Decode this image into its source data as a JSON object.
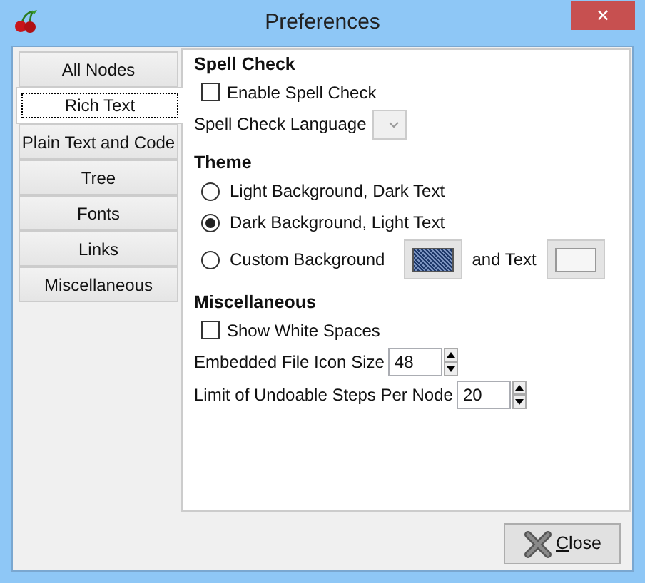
{
  "window": {
    "title": "Preferences",
    "close": "✕"
  },
  "tabs": [
    {
      "label": "All Nodes",
      "selected": false
    },
    {
      "label": "Rich Text",
      "selected": true
    },
    {
      "label": "Plain Text and Code",
      "selected": false
    },
    {
      "label": "Tree",
      "selected": false
    },
    {
      "label": "Fonts",
      "selected": false
    },
    {
      "label": "Links",
      "selected": false
    },
    {
      "label": "Miscellaneous",
      "selected": false
    }
  ],
  "sections": [
    {
      "title": "Spell Check",
      "items": [
        {
          "kind": "checkbox",
          "label": "Enable Spell Check",
          "checked": false
        },
        {
          "kind": "dropdown",
          "label": "Spell Check Language"
        }
      ]
    },
    {
      "title": "Theme",
      "items": [
        {
          "kind": "radio",
          "label": "Light Background, Dark Text",
          "selected": false
        },
        {
          "kind": "radio",
          "label": "Dark Background, Light Text",
          "selected": true
        },
        {
          "kind": "radio-colors",
          "label": "Custom Background",
          "selected": false,
          "second_label": "and Text"
        }
      ]
    },
    {
      "title": "Miscellaneous",
      "items": [
        {
          "kind": "checkbox",
          "label": "Show White Spaces",
          "checked": false
        },
        {
          "kind": "spinner",
          "label": "Embedded File Icon Size",
          "value": "48"
        },
        {
          "kind": "spinner",
          "label": "Limit of Undoable Steps Per Node",
          "value": "20"
        }
      ]
    }
  ],
  "close_button": "Close"
}
